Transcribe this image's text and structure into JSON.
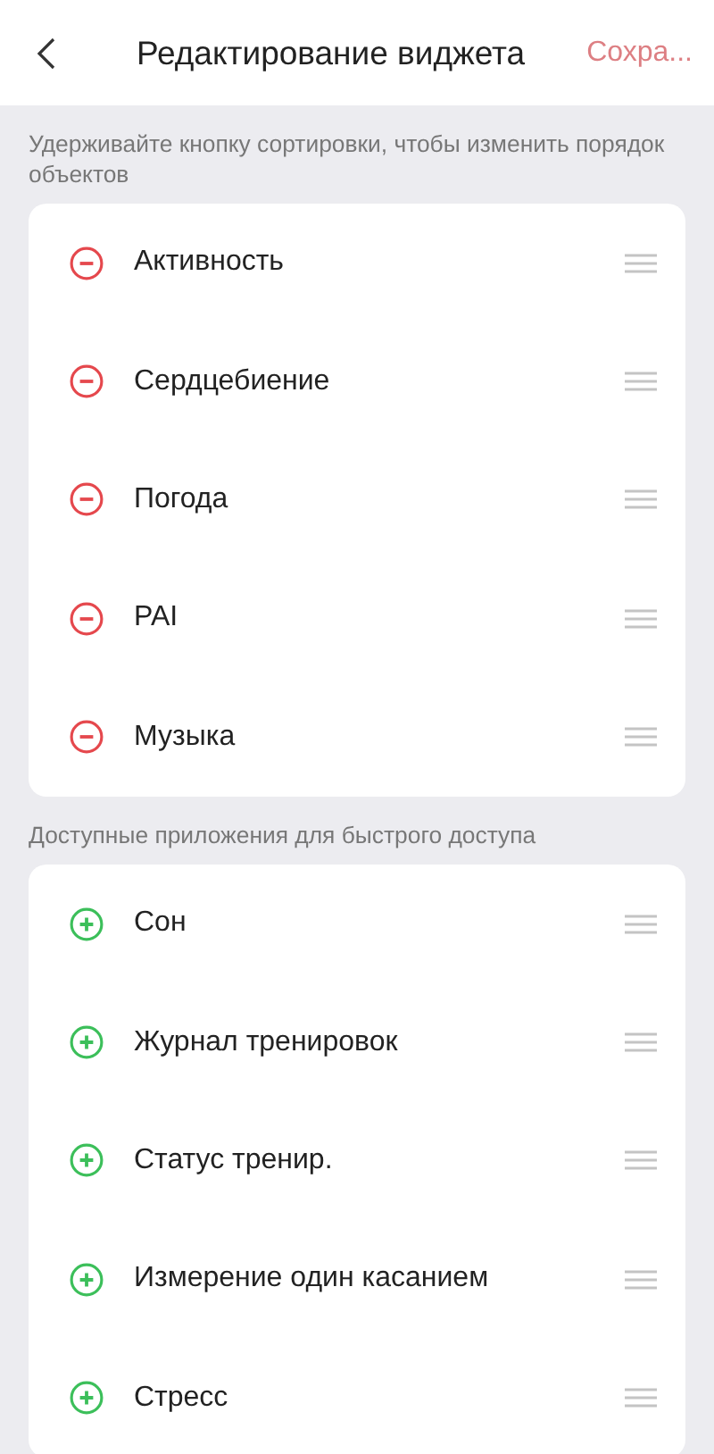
{
  "header": {
    "title": "Редактирование виджета",
    "save": {
      "label": "Сохра...",
      "disabled": true
    }
  },
  "sections": [
    {
      "caption": "Удерживайте кнопку сортировки, чтобы изменить порядок объектов",
      "items": [
        {
          "label": "Активность",
          "kind": "remove"
        },
        {
          "label": "Сердцебиение",
          "kind": "remove"
        },
        {
          "label": "Погода",
          "kind": "remove"
        },
        {
          "label": "PAI",
          "kind": "remove"
        },
        {
          "label": "Музыка",
          "kind": "remove"
        }
      ]
    },
    {
      "caption": "Доступные приложения для быстрого доступа",
      "items": [
        {
          "label": "Сон",
          "kind": "add"
        },
        {
          "label": "Журнал тренировок",
          "kind": "add"
        },
        {
          "label": "Статус тренир.",
          "kind": "add"
        },
        {
          "label": "Измерение один касанием",
          "kind": "add"
        },
        {
          "label": "Стресс",
          "kind": "add"
        }
      ]
    }
  ]
}
